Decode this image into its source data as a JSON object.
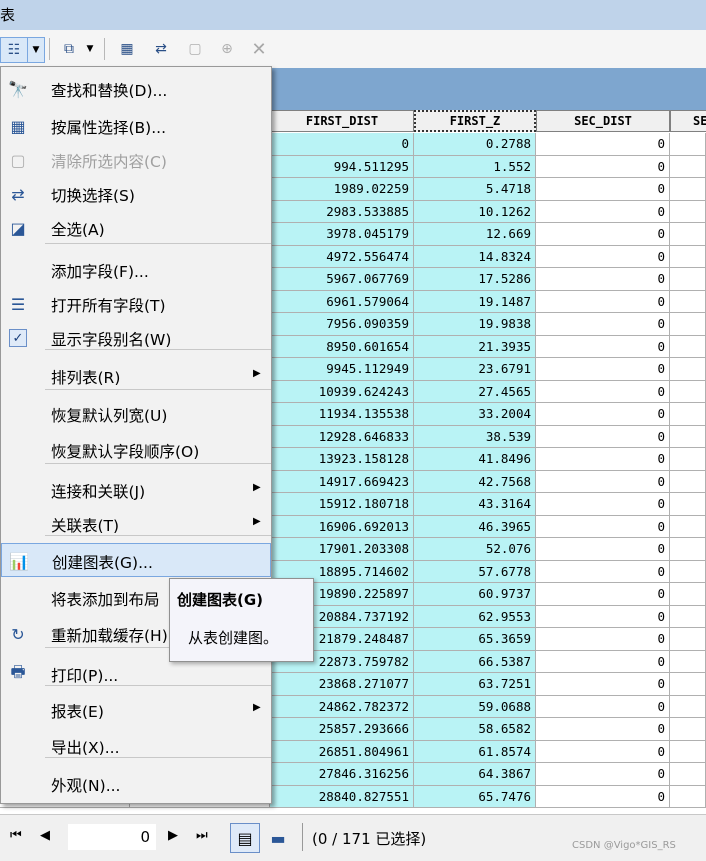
{
  "window": {
    "title": "表"
  },
  "columns": [
    "FIRST_DIST",
    "FIRST_Z",
    "SEC_DIST",
    "SE"
  ],
  "rows": [
    [
      "0",
      "0.2788",
      "0"
    ],
    [
      "994.511295",
      "1.552",
      "0"
    ],
    [
      "1989.02259",
      "5.4718",
      "0"
    ],
    [
      "2983.533885",
      "10.1262",
      "0"
    ],
    [
      "3978.045179",
      "12.669",
      "0"
    ],
    [
      "4972.556474",
      "14.8324",
      "0"
    ],
    [
      "5967.067769",
      "17.5286",
      "0"
    ],
    [
      "6961.579064",
      "19.1487",
      "0"
    ],
    [
      "7956.090359",
      "19.9838",
      "0"
    ],
    [
      "8950.601654",
      "21.3935",
      "0"
    ],
    [
      "9945.112949",
      "23.6791",
      "0"
    ],
    [
      "10939.624243",
      "27.4565",
      "0"
    ],
    [
      "11934.135538",
      "33.2004",
      "0"
    ],
    [
      "12928.646833",
      "38.539",
      "0"
    ],
    [
      "13923.158128",
      "41.8496",
      "0"
    ],
    [
      "14917.669423",
      "42.7568",
      "0"
    ],
    [
      "15912.180718",
      "43.3164",
      "0"
    ],
    [
      "16906.692013",
      "46.3965",
      "0"
    ],
    [
      "17901.203308",
      "52.076",
      "0"
    ],
    [
      "18895.714602",
      "57.6778",
      "0"
    ],
    [
      "19890.225897",
      "60.9737",
      "0"
    ],
    [
      "20884.737192",
      "62.9553",
      "0"
    ],
    [
      "21879.248487",
      "65.3659",
      "0"
    ],
    [
      "22873.759782",
      "66.5387",
      "0"
    ],
    [
      "23868.271077",
      "63.7251",
      "0"
    ],
    [
      "24862.782372",
      "59.0688",
      "0"
    ],
    [
      "25857.293666",
      "58.6582",
      "0"
    ],
    [
      "26851.804961",
      "61.8574",
      "0"
    ],
    [
      "27846.316256",
      "64.3867",
      "0"
    ],
    [
      "28840.827551",
      "65.7476",
      "0"
    ]
  ],
  "menu": {
    "items": [
      {
        "icon": "binoculars-icon",
        "glyph": "🔭",
        "label": "查找和替换(D)..."
      },
      {
        "icon": "select-by-attributes-icon",
        "glyph": "▦",
        "label": "按属性选择(B)..."
      },
      {
        "icon": "clear-selection-icon",
        "glyph": "▢",
        "label": "清除所选内容(C)",
        "disabled": true
      },
      {
        "icon": "switch-selection-icon",
        "glyph": "⇄",
        "label": "切换选择(S)"
      },
      {
        "icon": "select-all-icon",
        "glyph": "◪",
        "label": "全选(A)"
      },
      {
        "icon": "",
        "glyph": "",
        "label": "添加字段(F)..."
      },
      {
        "icon": "show-all-fields-icon",
        "glyph": "☰",
        "label": "打开所有字段(T)"
      },
      {
        "icon": "check-icon",
        "glyph": "✓",
        "label": "显示字段别名(W)"
      },
      {
        "icon": "",
        "glyph": "",
        "label": "排列表(R)",
        "submenu": true
      },
      {
        "icon": "",
        "glyph": "",
        "label": "恢复默认列宽(U)"
      },
      {
        "icon": "",
        "glyph": "",
        "label": "恢复默认字段顺序(O)"
      },
      {
        "icon": "",
        "glyph": "",
        "label": "连接和关联(J)",
        "submenu": true
      },
      {
        "icon": "",
        "glyph": "",
        "label": "关联表(T)",
        "submenu": true
      },
      {
        "icon": "bar-chart-icon",
        "glyph": "📊",
        "label": "创建图表(G)...",
        "highlighted": true
      },
      {
        "icon": "",
        "glyph": "",
        "label": "将表添加到布局"
      },
      {
        "icon": "reload-icon",
        "glyph": "↻",
        "label": "重新加载缓存(H)"
      },
      {
        "icon": "printer-icon",
        "glyph": "🖶",
        "label": "打印(P)..."
      },
      {
        "icon": "",
        "glyph": "",
        "label": "报表(E)",
        "submenu": true
      },
      {
        "icon": "",
        "glyph": "",
        "label": "导出(X)..."
      },
      {
        "icon": "",
        "glyph": "",
        "label": "外观(N)..."
      }
    ]
  },
  "tooltip": {
    "title": "创建图表(G)",
    "description": "从表创建图。"
  },
  "status": {
    "record": "0",
    "selection": "(0 / 171 已选择)"
  },
  "watermark": "CSDN @Vigo*GIS_RS"
}
